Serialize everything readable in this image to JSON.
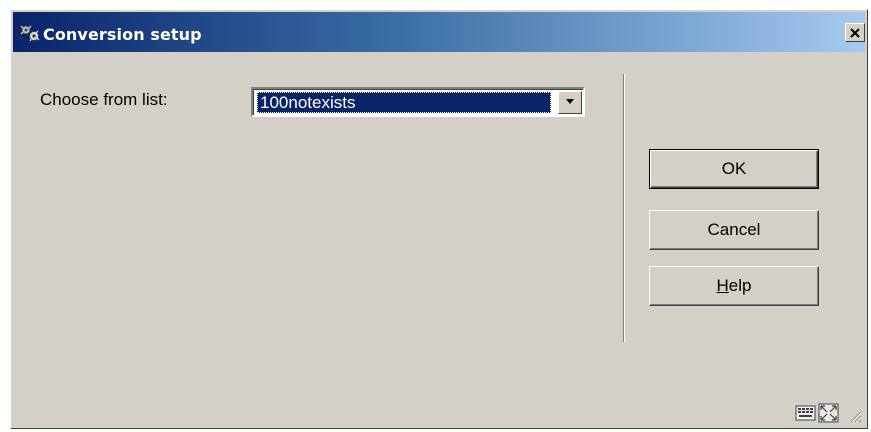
{
  "window": {
    "title": "Conversion setup",
    "title_icon": "conversion-gears-icon",
    "close_icon": "close-icon"
  },
  "form": {
    "choose_label": "Choose from list:",
    "selected_value": "100notexists",
    "dropdown_icon": "chevron-down-icon"
  },
  "buttons": {
    "ok": "OK",
    "cancel": "Cancel",
    "help_mnemonic": "H",
    "help_rest": "elp"
  },
  "status_bar": {
    "icons": [
      "keyboard-icon",
      "resize-icon",
      "size-grip-icon"
    ]
  },
  "colors": {
    "title_start": "#0a246a",
    "title_end": "#a6caf0",
    "face": "#d4d0c8",
    "selection": "#0a246a"
  }
}
